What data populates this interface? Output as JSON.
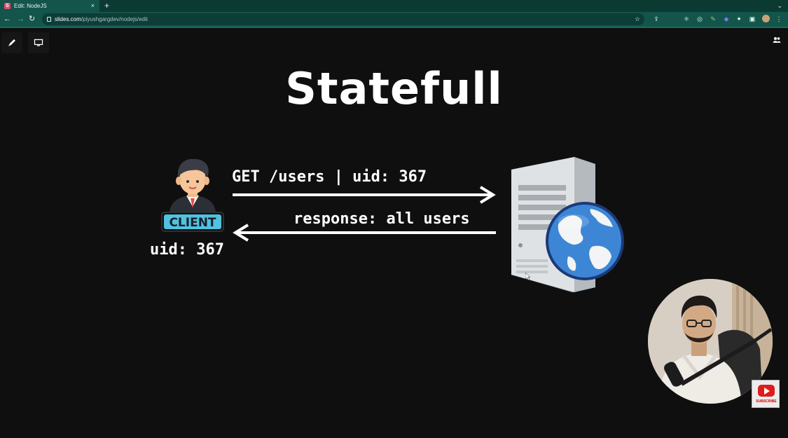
{
  "browser": {
    "tab_title": "Edit: NodeJS",
    "tab_favicon_letter": "S",
    "tab_close": "×",
    "new_tab": "+",
    "tab_menu": "⌄",
    "url_host": "slides.com",
    "url_path": "/piyushgargdev/nodejs/edit"
  },
  "slide": {
    "title": "Statefull",
    "request_label": "GET /users | uid: 367",
    "response_label": "response: all users",
    "client_badge": "CLIENT",
    "client_uid": "uid: 367"
  },
  "overlay": {
    "subscribe_label": "SUBSCRIBE"
  },
  "colors": {
    "browser_frame": "#14554b",
    "slide_background": "#0f0f0f",
    "client_badge": "#4fc3e0"
  }
}
